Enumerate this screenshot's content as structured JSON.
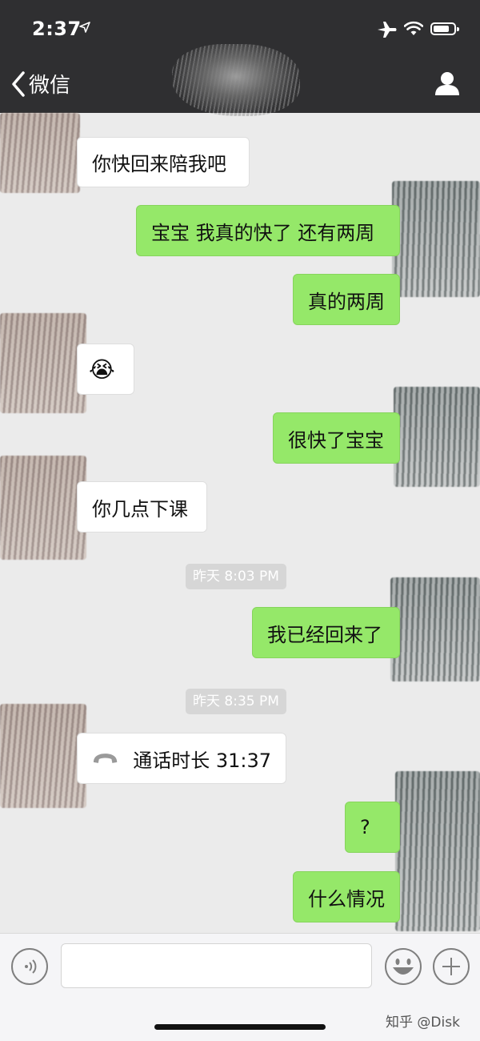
{
  "status": {
    "time": "2:37"
  },
  "nav": {
    "back_label": "微信",
    "contact_name": ""
  },
  "messages": [
    {
      "text": "你快回来陪我吧"
    },
    {
      "text": "宝宝 我真的快了 还有两周"
    },
    {
      "text": "真的两周"
    },
    {
      "text": "😭"
    },
    {
      "text": "很快了宝宝"
    },
    {
      "text": "你几点下课"
    },
    {
      "text": "昨天 8:03 PM"
    },
    {
      "text": "我已经回来了"
    },
    {
      "text": "昨天 8:35 PM"
    },
    {
      "text": "通话时长 31:37"
    },
    {
      "text": "?"
    },
    {
      "text": "什么情况"
    }
  ],
  "input": {
    "value": "",
    "placeholder": ""
  },
  "watermark": "知乎 @Disk",
  "colors": {
    "header_bg": "#2f2f31",
    "chat_bg": "#ebebeb",
    "out_bubble": "#95e869",
    "in_bubble": "#ffffff",
    "timestamp_bg": "#d6d6d6"
  },
  "icons": [
    "location-arrow-icon",
    "airplane-icon",
    "wifi-icon",
    "battery-icon",
    "chevron-left-icon",
    "person-icon",
    "phone-handset-icon",
    "voice-icon",
    "emoji-icon",
    "plus-icon"
  ]
}
